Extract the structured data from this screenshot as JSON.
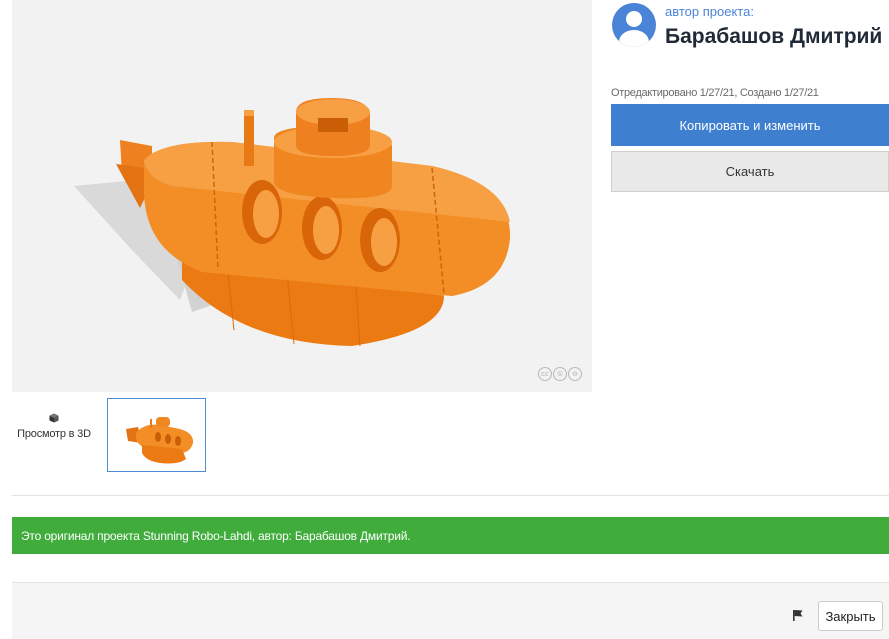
{
  "viewer": {
    "model_alt": "Orange submarine 3D model",
    "license_badge_icons": [
      "cc-icon",
      "by-icon",
      "nc-icon"
    ],
    "accent_color": "#f0841c"
  },
  "author": {
    "caption": "автор проекта:",
    "name": "Барабашов Дмитрий",
    "avatar_icon": "user-avatar-icon"
  },
  "meta": {
    "dates": "Отредактировано 1/27/21, Создано 1/27/21"
  },
  "actions": {
    "copy_label": "Копировать и изменить",
    "download_label": "Скачать",
    "primary_color": "#3f7fd0"
  },
  "gallery": {
    "view3d_label": "Просмотр в 3D",
    "view3d_icon": "cube-icon"
  },
  "notice": {
    "text": "Это оригинал проекта Stunning Robo-Lahdi, автор: Барабашов Дмитрий.",
    "color": "#3fac3b"
  },
  "footer": {
    "flag_icon": "flag-icon",
    "close_label": "Закрыть"
  }
}
